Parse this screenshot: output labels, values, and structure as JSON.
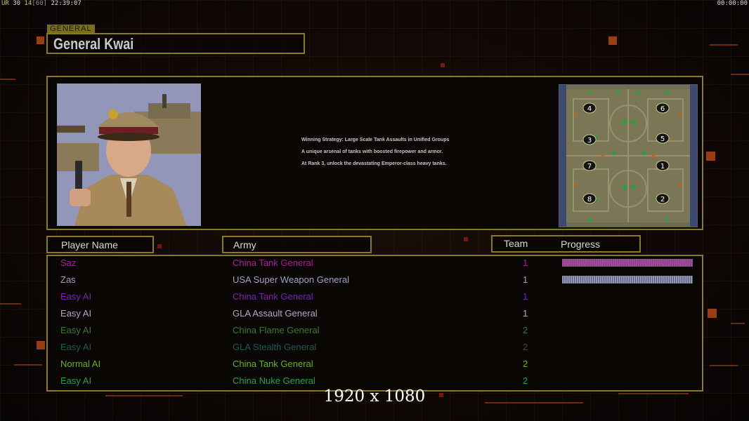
{
  "hud": {
    "ur_label": "UR",
    "ur_value": "30",
    "fps_current": "14",
    "fps_cap": "[60]",
    "system_time": "22:39:07",
    "game_timer": "00:00:00"
  },
  "general": {
    "tag": "GENERAL",
    "name": "General Kwai"
  },
  "strategy": {
    "lines": [
      "Winning Strategy: Large Scale Tank Assaults in Unified Groups",
      "A unique arsenal of tanks with boosted firepower and armor.",
      "At Rank 3, unlock the devastating Emperor-class heavy tanks."
    ]
  },
  "minimap": {
    "start_positions": [
      "4",
      "6",
      "3",
      "5",
      "7",
      "1",
      "8",
      "2"
    ]
  },
  "columns": {
    "player_name": "Player Name",
    "army": "Army",
    "team": "Team",
    "progress": "Progress"
  },
  "players": [
    {
      "name": "Saz",
      "army": "China Tank General",
      "team": "1",
      "color": "#a0209a",
      "progress": 1.0,
      "progress_color": "#b040b0"
    },
    {
      "name": "Zas",
      "army": "USA Super Weapon General",
      "team": "1",
      "color": "#9aa4c8",
      "progress": 1.0,
      "progress_color": "#8c98c0"
    },
    {
      "name": "Easy AI",
      "army": "China Tank General",
      "team": "1",
      "color": "#7a20a8",
      "progress": null
    },
    {
      "name": "Easy AI",
      "army": "GLA Assault General",
      "team": "1",
      "color": "#b8a4c8",
      "progress": null
    },
    {
      "name": "Easy AI",
      "army": "China Flame General",
      "team": "2",
      "color": "#3a7a30",
      "progress": null
    },
    {
      "name": "Easy AI",
      "army": "GLA Stealth General",
      "team": "2",
      "color": "#1e5858",
      "progress": null
    },
    {
      "name": "Normal AI",
      "army": "China Tank General",
      "team": "2",
      "color": "#6ab01e",
      "progress": null
    },
    {
      "name": "Easy AI",
      "army": "China Nuke General",
      "team": "2",
      "color": "#28a040",
      "progress": null
    }
  ],
  "resolution_label": "1920 x 1080",
  "colors": {
    "frame": "#8a7a1e",
    "background": "#120906"
  }
}
